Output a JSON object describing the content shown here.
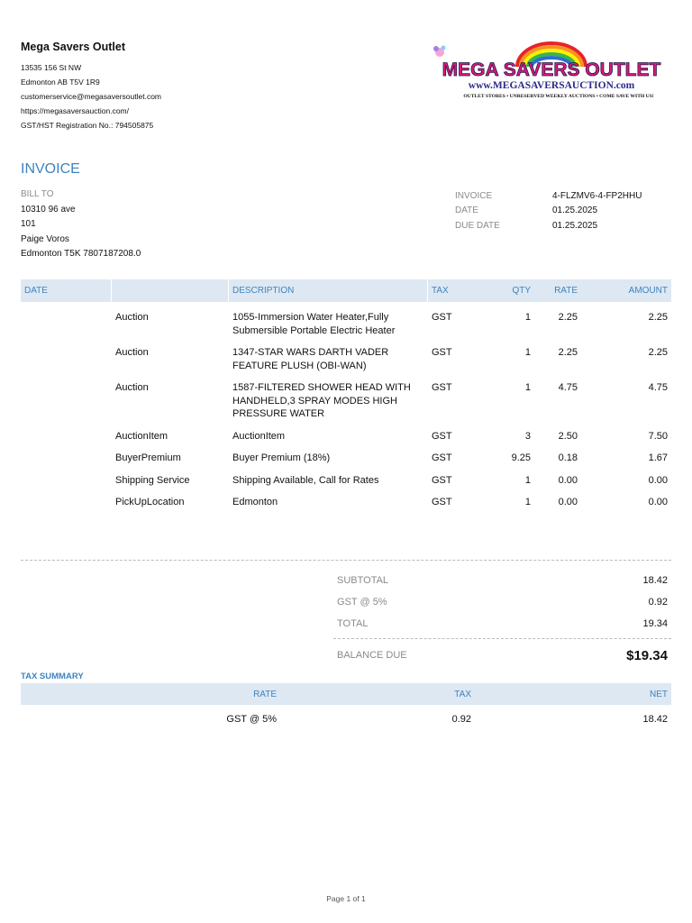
{
  "company": {
    "name": "Mega Savers Outlet",
    "lines": [
      "13535 156 St NW",
      "Edmonton AB  T5V 1R9",
      "customerservice@megasaversoutlet.com",
      "https://megasaversauction.com/",
      "GST/HST Registration No.: 794505875"
    ]
  },
  "logo": {
    "title": "MEGA SAVERS OUTLET",
    "url": "www.MEGASAVERSAUCTION.com",
    "tagline": "OUTLET STORES • UNRESERVED WEEKLY AUCTIONS • COME SAVE WITH US!",
    "title_color": "#e0187a",
    "url_color": "#2a2a8a"
  },
  "invoice_title": "INVOICE",
  "bill_to": {
    "label": "BILL TO",
    "lines": [
      "10310 96 ave",
      "101",
      "Paige Voros",
      "Edmonton  T5K 7807187208.0"
    ]
  },
  "meta": [
    {
      "label": "INVOICE",
      "value": "4-FLZMV6-4-FP2HHU"
    },
    {
      "label": "DATE",
      "value": "01.25.2025"
    },
    {
      "label": "DUE DATE",
      "value": "01.25.2025"
    }
  ],
  "items": {
    "headers": {
      "date": "DATE",
      "product": "",
      "description": "DESCRIPTION",
      "tax": "TAX",
      "qty": "QTY",
      "rate": "RATE",
      "amount": "AMOUNT"
    },
    "rows": [
      {
        "date": "",
        "product": "Auction",
        "description": "1055-Immersion Water Heater,Fully Submersible Portable Electric Heater",
        "tax": "GST",
        "qty": "1",
        "rate": "2.25",
        "amount": "2.25"
      },
      {
        "date": "",
        "product": "Auction",
        "description": "1347-STAR WARS DARTH VADER FEATURE PLUSH (OBI-WAN)",
        "tax": "GST",
        "qty": "1",
        "rate": "2.25",
        "amount": "2.25"
      },
      {
        "date": "",
        "product": "Auction",
        "description": "1587-FILTERED SHOWER HEAD WITH HANDHELD,3 SPRAY MODES HIGH PRESSURE WATER",
        "tax": "GST",
        "qty": "1",
        "rate": "4.75",
        "amount": "4.75"
      },
      {
        "date": "",
        "product": "AuctionItem",
        "description": "AuctionItem",
        "tax": "GST",
        "qty": "3",
        "rate": "2.50",
        "amount": "7.50"
      },
      {
        "date": "",
        "product": "BuyerPremium",
        "description": "Buyer Premium (18%)",
        "tax": "GST",
        "qty": "9.25",
        "rate": "0.18",
        "amount": "1.67"
      },
      {
        "date": "",
        "product": "Shipping Service",
        "description": "Shipping Available, Call for Rates",
        "tax": "GST",
        "qty": "1",
        "rate": "0.00",
        "amount": "0.00"
      },
      {
        "date": "",
        "product": "PickUpLocation",
        "description": "Edmonton",
        "tax": "GST",
        "qty": "1",
        "rate": "0.00",
        "amount": "0.00"
      }
    ]
  },
  "totals": {
    "subtotal_label": "SUBTOTAL",
    "subtotal": "18.42",
    "gst_label": "GST @ 5%",
    "gst": "0.92",
    "total_label": "TOTAL",
    "total": "19.34",
    "balance_label": "BALANCE DUE",
    "balance": "$19.34"
  },
  "tax_summary": {
    "title": "TAX SUMMARY",
    "headers": {
      "rate": "RATE",
      "tax": "TAX",
      "net": "NET"
    },
    "rows": [
      {
        "rate": "GST @ 5%",
        "tax": "0.92",
        "net": "18.42"
      }
    ]
  },
  "footer": "Page 1 of 1"
}
